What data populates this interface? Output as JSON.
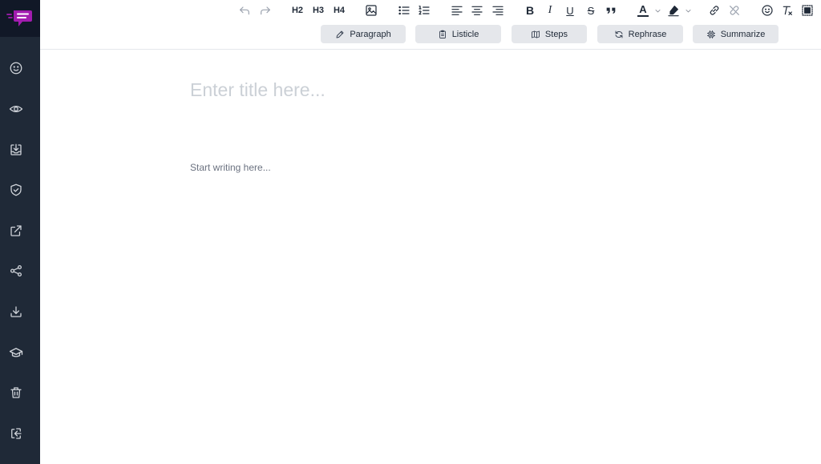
{
  "brand": {
    "logo_icon": "chat-bubble-logo-icon",
    "accent": "#a21caf"
  },
  "sidebar": {
    "items": [
      {
        "icon": "smiley-icon"
      },
      {
        "icon": "eye-icon"
      },
      {
        "icon": "inbox-download-icon"
      },
      {
        "icon": "shield-check-icon"
      },
      {
        "icon": "external-link-icon"
      },
      {
        "icon": "share-icon"
      },
      {
        "icon": "download-icon"
      },
      {
        "icon": "graduation-cap-icon"
      },
      {
        "icon": "trash-icon"
      },
      {
        "icon": "logout-icon"
      }
    ]
  },
  "toolbar": {
    "headings": {
      "h2": "H2",
      "h3": "H3",
      "h4": "H4"
    },
    "format": {
      "bold": "B",
      "italic": "I",
      "underline": "U",
      "strike": "S",
      "font_color": "A"
    }
  },
  "ai_actions": {
    "paragraph": "Paragraph",
    "listicle": "Listicle",
    "steps": "Steps",
    "rephrase": "Rephrase",
    "summarize": "Summarize"
  },
  "editor": {
    "title_placeholder": "Enter title here...",
    "body_placeholder": "Start writing here..."
  }
}
